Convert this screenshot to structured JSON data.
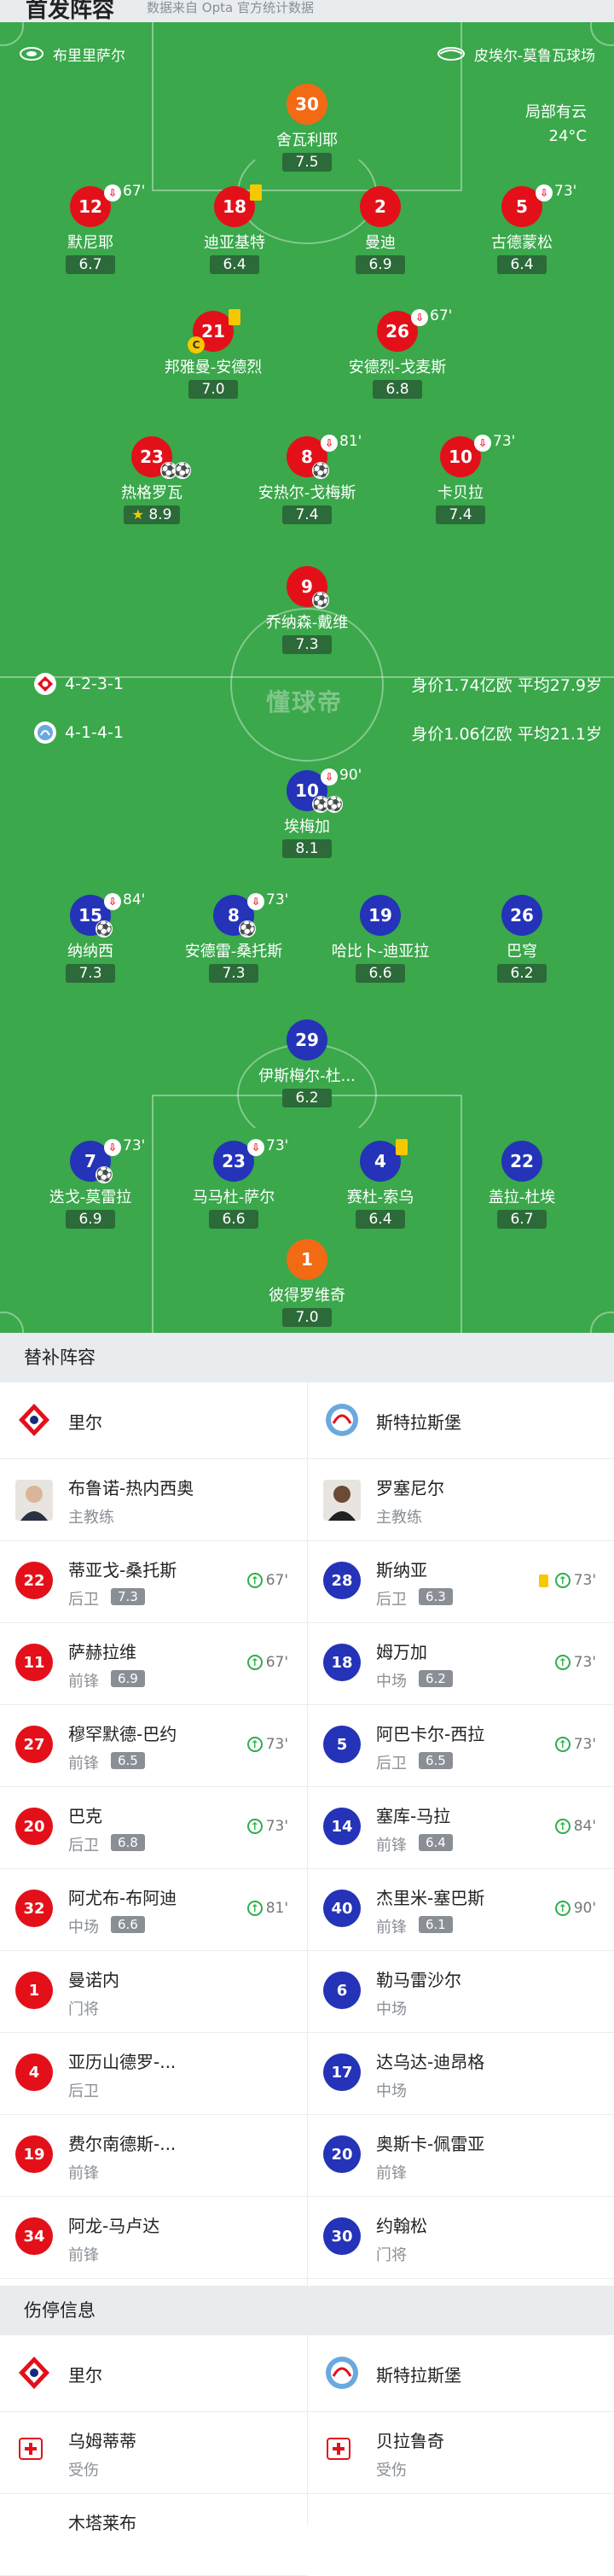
{
  "header": {
    "title": "首发阵容",
    "note": "数据来自 Opta 官方统计数据"
  },
  "pitch": {
    "home_venue": "布里里萨尔",
    "away_venue": "皮埃尔-莫鲁瓦球场",
    "weather": "局部有云",
    "temperature": "24°C",
    "watermark": "懂球帝",
    "home_formation": "4-2-3-1",
    "home_market": "身价1.74亿欧  平均27.9岁",
    "away_formation": "4-1-4-1",
    "away_market": "身价1.06亿欧  平均21.1岁"
  },
  "home_players": [
    {
      "num": "30",
      "name": "舍瓦利耶",
      "rating": "7.5"
    },
    {
      "num": "12",
      "name": "默尼耶",
      "rating": "6.7",
      "sub": "67'"
    },
    {
      "num": "18",
      "name": "迪亚基特",
      "rating": "6.4"
    },
    {
      "num": "2",
      "name": "曼迪",
      "rating": "6.9"
    },
    {
      "num": "5",
      "name": "古德蒙松",
      "rating": "6.4",
      "sub": "73'"
    },
    {
      "num": "21",
      "name": "邦雅曼-安德烈",
      "rating": "7.0"
    },
    {
      "num": "26",
      "name": "安德烈-戈麦斯",
      "rating": "6.8",
      "sub": "67'"
    },
    {
      "num": "23",
      "name": "热格罗瓦",
      "rating": "8.9"
    },
    {
      "num": "8",
      "name": "安热尔-戈梅斯",
      "rating": "7.4",
      "sub": "81'"
    },
    {
      "num": "10",
      "name": "卡贝拉",
      "rating": "7.4",
      "sub": "73'"
    },
    {
      "num": "9",
      "name": "乔纳森-戴维",
      "rating": "7.3"
    }
  ],
  "away_players": [
    {
      "num": "10",
      "name": "埃梅加",
      "rating": "8.1",
      "sub": "90'"
    },
    {
      "num": "15",
      "name": "纳纳西",
      "rating": "7.3",
      "sub": "84'"
    },
    {
      "num": "8",
      "name": "安德雷-桑托斯",
      "rating": "7.3",
      "sub": "73'"
    },
    {
      "num": "19",
      "name": "哈比卜-迪亚拉",
      "rating": "6.6"
    },
    {
      "num": "26",
      "name": "巴穹",
      "rating": "6.2"
    },
    {
      "num": "29",
      "name": "伊斯梅尔-杜...",
      "rating": "6.2"
    },
    {
      "num": "7",
      "name": "迭戈-莫雷拉",
      "rating": "6.9",
      "sub": "73'"
    },
    {
      "num": "23",
      "name": "马马杜-萨尔",
      "rating": "6.6",
      "sub": "73'"
    },
    {
      "num": "4",
      "name": "赛杜-索乌",
      "rating": "6.4"
    },
    {
      "num": "22",
      "name": "盖拉-杜埃",
      "rating": "6.7"
    },
    {
      "num": "1",
      "name": "彼得罗维奇",
      "rating": "7.0"
    }
  ],
  "bench": {
    "heading": "替补阵容",
    "home_team": "里尔",
    "away_team": "斯特拉斯堡",
    "home_coach": {
      "name": "布鲁诺-热内西奥",
      "role": "主教练"
    },
    "away_coach": {
      "name": "罗塞尼尔",
      "role": "主教练"
    },
    "home": [
      {
        "num": "22",
        "name": "蒂亚戈-桑托斯",
        "pos": "后卫",
        "rating": "7.3",
        "sub": "67'"
      },
      {
        "num": "11",
        "name": "萨赫拉维",
        "pos": "前锋",
        "rating": "6.9",
        "sub": "67'"
      },
      {
        "num": "27",
        "name": "穆罕默德-巴约",
        "pos": "前锋",
        "rating": "6.5",
        "sub": "73'"
      },
      {
        "num": "20",
        "name": "巴克",
        "pos": "后卫",
        "rating": "6.8",
        "sub": "73'"
      },
      {
        "num": "32",
        "name": "阿尤布-布阿迪",
        "pos": "中场",
        "rating": "6.6",
        "sub": "81'"
      },
      {
        "num": "1",
        "name": "曼诺内",
        "pos": "门将"
      },
      {
        "num": "4",
        "name": "亚历山德罗-...",
        "pos": "后卫"
      },
      {
        "num": "19",
        "name": "费尔南德斯-...",
        "pos": "前锋"
      },
      {
        "num": "34",
        "name": "阿龙-马卢达",
        "pos": "前锋"
      }
    ],
    "away": [
      {
        "num": "28",
        "name": "斯纳亚",
        "pos": "后卫",
        "rating": "6.3",
        "sub": "73'",
        "yellow": true
      },
      {
        "num": "18",
        "name": "姆万加",
        "pos": "中场",
        "rating": "6.2",
        "sub": "73'"
      },
      {
        "num": "5",
        "name": "阿巴卡尔-西拉",
        "pos": "后卫",
        "rating": "6.5",
        "sub": "73'"
      },
      {
        "num": "14",
        "name": "塞库-马拉",
        "pos": "前锋",
        "rating": "6.4",
        "sub": "84'"
      },
      {
        "num": "40",
        "name": "杰里米-塞巴斯",
        "pos": "前锋",
        "rating": "6.1",
        "sub": "90'"
      },
      {
        "num": "6",
        "name": "勒马雷沙尔",
        "pos": "中场"
      },
      {
        "num": "17",
        "name": "达乌达-迪昂格",
        "pos": "中场"
      },
      {
        "num": "20",
        "name": "奥斯卡-佩雷亚",
        "pos": "前锋"
      },
      {
        "num": "30",
        "name": "约翰松",
        "pos": "门将"
      }
    ]
  },
  "injury": {
    "heading": "伤停信息",
    "home_team": "里尔",
    "away_team": "斯特拉斯堡",
    "home": [
      {
        "name": "乌姆蒂蒂",
        "status": "受伤"
      },
      {
        "name": "木塔莱布"
      }
    ],
    "away": [
      {
        "name": "贝拉鲁奇",
        "status": "受伤"
      }
    ]
  },
  "colors": {
    "home": "#e3101a",
    "away": "#2433b8",
    "goalkeeper": "#f36a14",
    "pitch": "#3aa84b"
  }
}
